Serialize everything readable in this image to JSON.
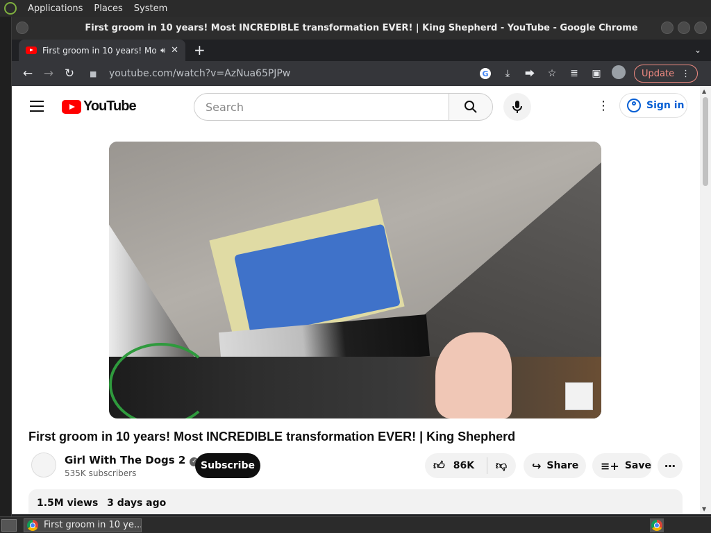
{
  "top_panel": {
    "menus": [
      "Applications",
      "Places",
      "System"
    ]
  },
  "window": {
    "title": "First groom in 10 years! Most INCREDIBLE transformation EVER! | King Shepherd - YouTube - Google Chrome"
  },
  "tab": {
    "title": "First groom in 10 years! Mo",
    "audio_icon": "speaker-icon",
    "close_glyph": "✕"
  },
  "new_tab_glyph": "+",
  "toolbar": {
    "url": "youtube.com/watch?v=AzNua65PJPw",
    "update_label": "Update"
  },
  "youtube": {
    "logo_text": "YouTube",
    "search_placeholder": "Search",
    "signin_label": "Sign in",
    "video_title": "First groom in 10 years! Most INCREDIBLE transformation EVER! | King Shepherd",
    "channel_name": "Girl With The Dogs 2",
    "subscribers": "535K subscribers",
    "subscribe_label": "Subscribe",
    "likes": "86K",
    "share_label": "Share",
    "save_label": "Save",
    "views": "1.5M views",
    "posted": "3 days ago"
  },
  "taskbar": {
    "task_label": "First groom in 10 ye..."
  },
  "colors": {
    "youtube_red": "#ff0000",
    "link_blue": "#065fd4",
    "update_red": "#f28b82"
  }
}
